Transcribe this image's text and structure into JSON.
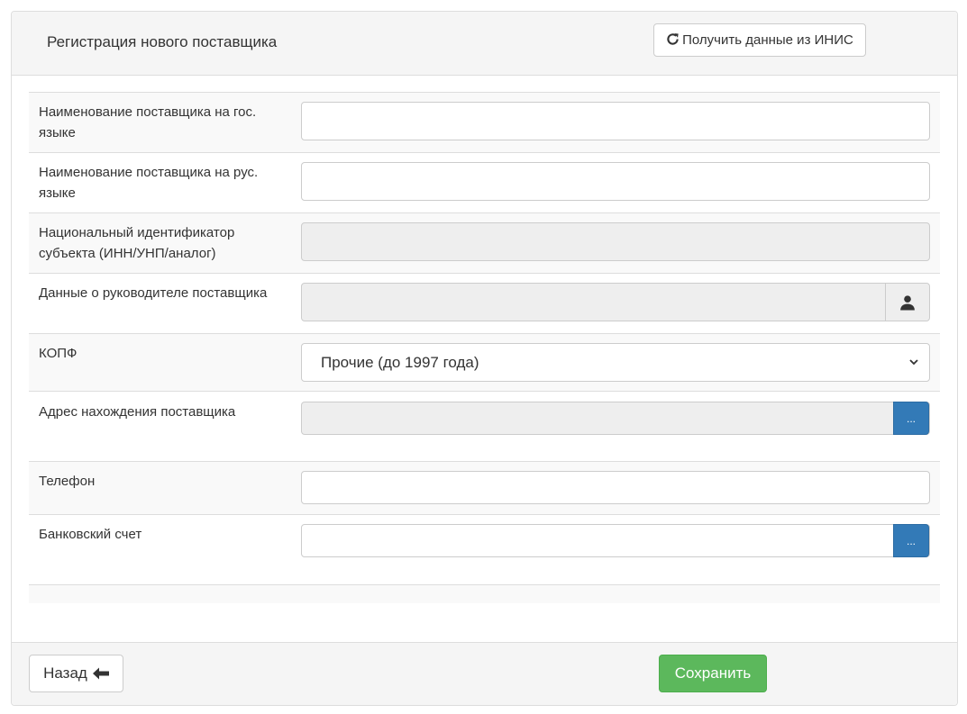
{
  "header": {
    "title": "Регистрация нового поставщика",
    "inis_button_label": "Получить данные из ИНИС",
    "inis_button_icon": "refresh-icon"
  },
  "form": {
    "name_state_label": "Наименование поставщика на гос. языке",
    "name_state_value": "",
    "name_rus_label": "Наименование поставщика на рус. языке",
    "name_rus_value": "",
    "national_id_label": "Национальный идентификатор субъекта (ИНН/УНП/аналог)",
    "national_id_value": "",
    "director_label": "Данные о руководителе поставщика",
    "director_value": "",
    "director_icon": "user-icon",
    "kopf_label": "КОПФ",
    "kopf_selected": "Прочие (до 1997 года)",
    "address_label": "Адрес нахождения поставщика",
    "address_value": "",
    "address_button_label": "...",
    "phone_label": "Телефон",
    "phone_value": "",
    "bank_label": "Банковский счет",
    "bank_value": "",
    "bank_button_label": "..."
  },
  "footer": {
    "back_label": "Назад",
    "back_icon": "arrow-left-icon",
    "save_label": "Сохранить"
  },
  "colors": {
    "primary": "#337ab7",
    "success": "#5cb85c",
    "panel_bg": "#f5f5f5",
    "border": "#dddddd"
  }
}
